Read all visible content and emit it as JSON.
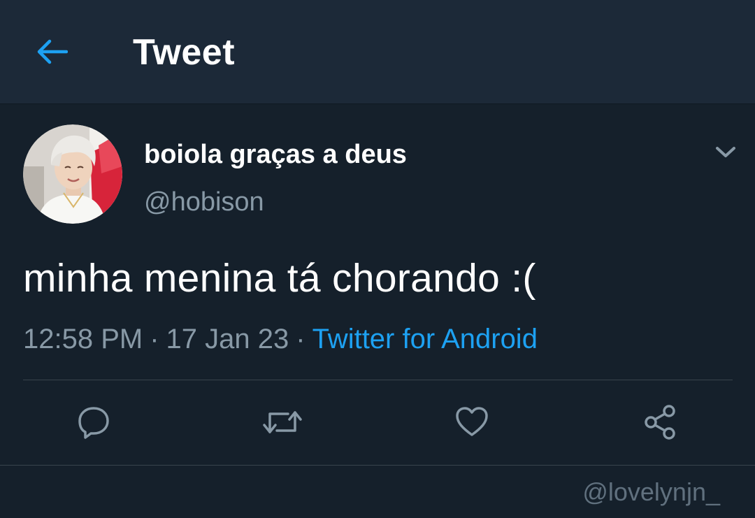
{
  "header": {
    "back_icon": "arrow-left-icon",
    "title": "Tweet"
  },
  "tweet": {
    "display_name": "boiola graças a deus",
    "handle": "@hobison",
    "text": "minha menina tá chorando :(",
    "time": "12:58 PM",
    "separator": "·",
    "date": "17 Jan 23",
    "source": "Twitter for Android",
    "menu_icon": "chevron-down-icon"
  },
  "actions": [
    {
      "name": "reply",
      "icon": "reply-icon"
    },
    {
      "name": "retweet",
      "icon": "retweet-icon"
    },
    {
      "name": "like",
      "icon": "heart-icon"
    },
    {
      "name": "share",
      "icon": "share-icon"
    }
  ],
  "watermark": "@lovelynjn_",
  "colors": {
    "background": "#15202b",
    "header_background": "#1c2938",
    "primary_text": "#ffffff",
    "secondary_text": "#8899a6",
    "accent": "#1da1f2",
    "divider": "#38444d"
  }
}
